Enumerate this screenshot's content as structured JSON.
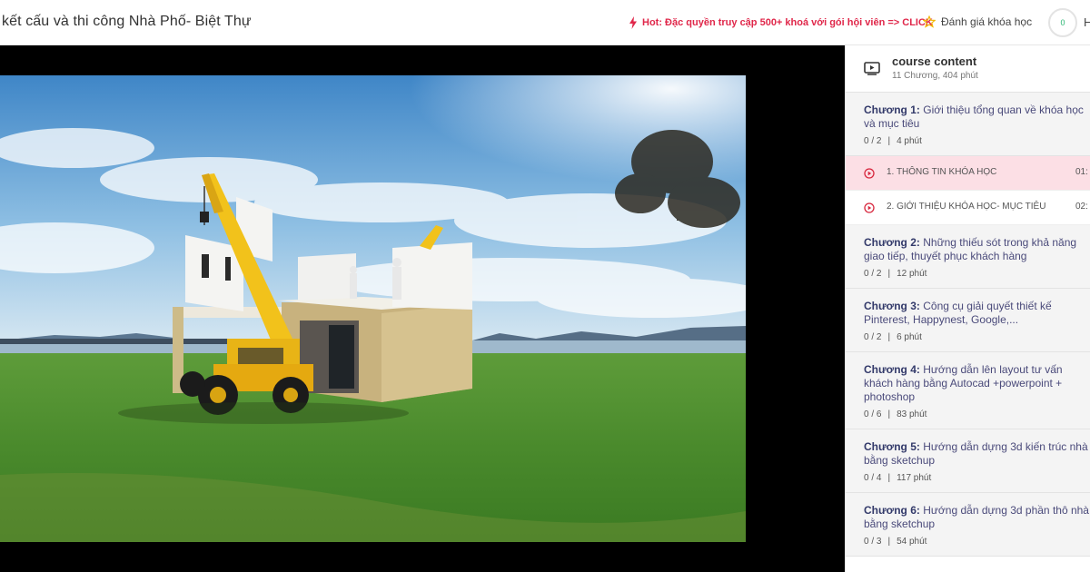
{
  "header": {
    "course_title": "kết cấu và thi công Nhà Phố- Biệt Thự",
    "hot_link": "Hot: Đặc quyền truy cập 500+ khoá với gói hội viên => CLICK",
    "rate_label": "Đánh giá khóa học",
    "progress_value": "0",
    "help_partial": "H",
    "icons": {
      "hot": "lightning-icon",
      "rate": "star-icon"
    },
    "colors": {
      "hot": "#e0274a",
      "star": "#f2b705",
      "progress": "#2bb673"
    }
  },
  "player": {
    "scene": "3D render: yellow crane building a house on green grass by the sea"
  },
  "sidebar": {
    "title": "course content",
    "summary": "11 Chương, 404 phút",
    "chapters": [
      {
        "label": "Chương 1:",
        "name": "Giới thiệu tổng quan về khóa học và mục tiêu",
        "progress": "0 / 2",
        "duration": "4 phút"
      },
      {
        "label": "Chương 2:",
        "name": "Những thiếu sót trong khả năng giao tiếp, thuyết phục khách hàng",
        "progress": "0 / 2",
        "duration": "12 phút"
      },
      {
        "label": "Chương 3:",
        "name": "Công cụ giải quyết thiết kế Pinterest, Happynest, Google,...",
        "progress": "0 / 2",
        "duration": "6 phút"
      },
      {
        "label": "Chương 4:",
        "name": "Hướng dẫn lên layout tư vấn khách hàng bằng Autocad +powerpoint + photoshop",
        "progress": "0 / 6",
        "duration": "83 phút"
      },
      {
        "label": "Chương 5:",
        "name": "Hướng dẫn dựng 3d kiến trúc nhà bằng sketchup",
        "progress": "0 / 4",
        "duration": "117 phút"
      },
      {
        "label": "Chương 6:",
        "name": "Hướng dẫn dựng 3d phần thô nhà bằng sketchup",
        "progress": "0 / 3",
        "duration": "54 phút"
      }
    ],
    "lessons": [
      {
        "name": "1. THÔNG TIN KHÓA HỌC",
        "time": "01:",
        "active": true
      },
      {
        "name": "2. GIỚI THIỆU KHÓA HỌC- MỤC TIÊU",
        "time": "02:",
        "active": false
      }
    ],
    "separator": "|",
    "colors": {
      "active_lesson_bg": "#fcdfe5",
      "play_icon": "#d7263d"
    }
  }
}
